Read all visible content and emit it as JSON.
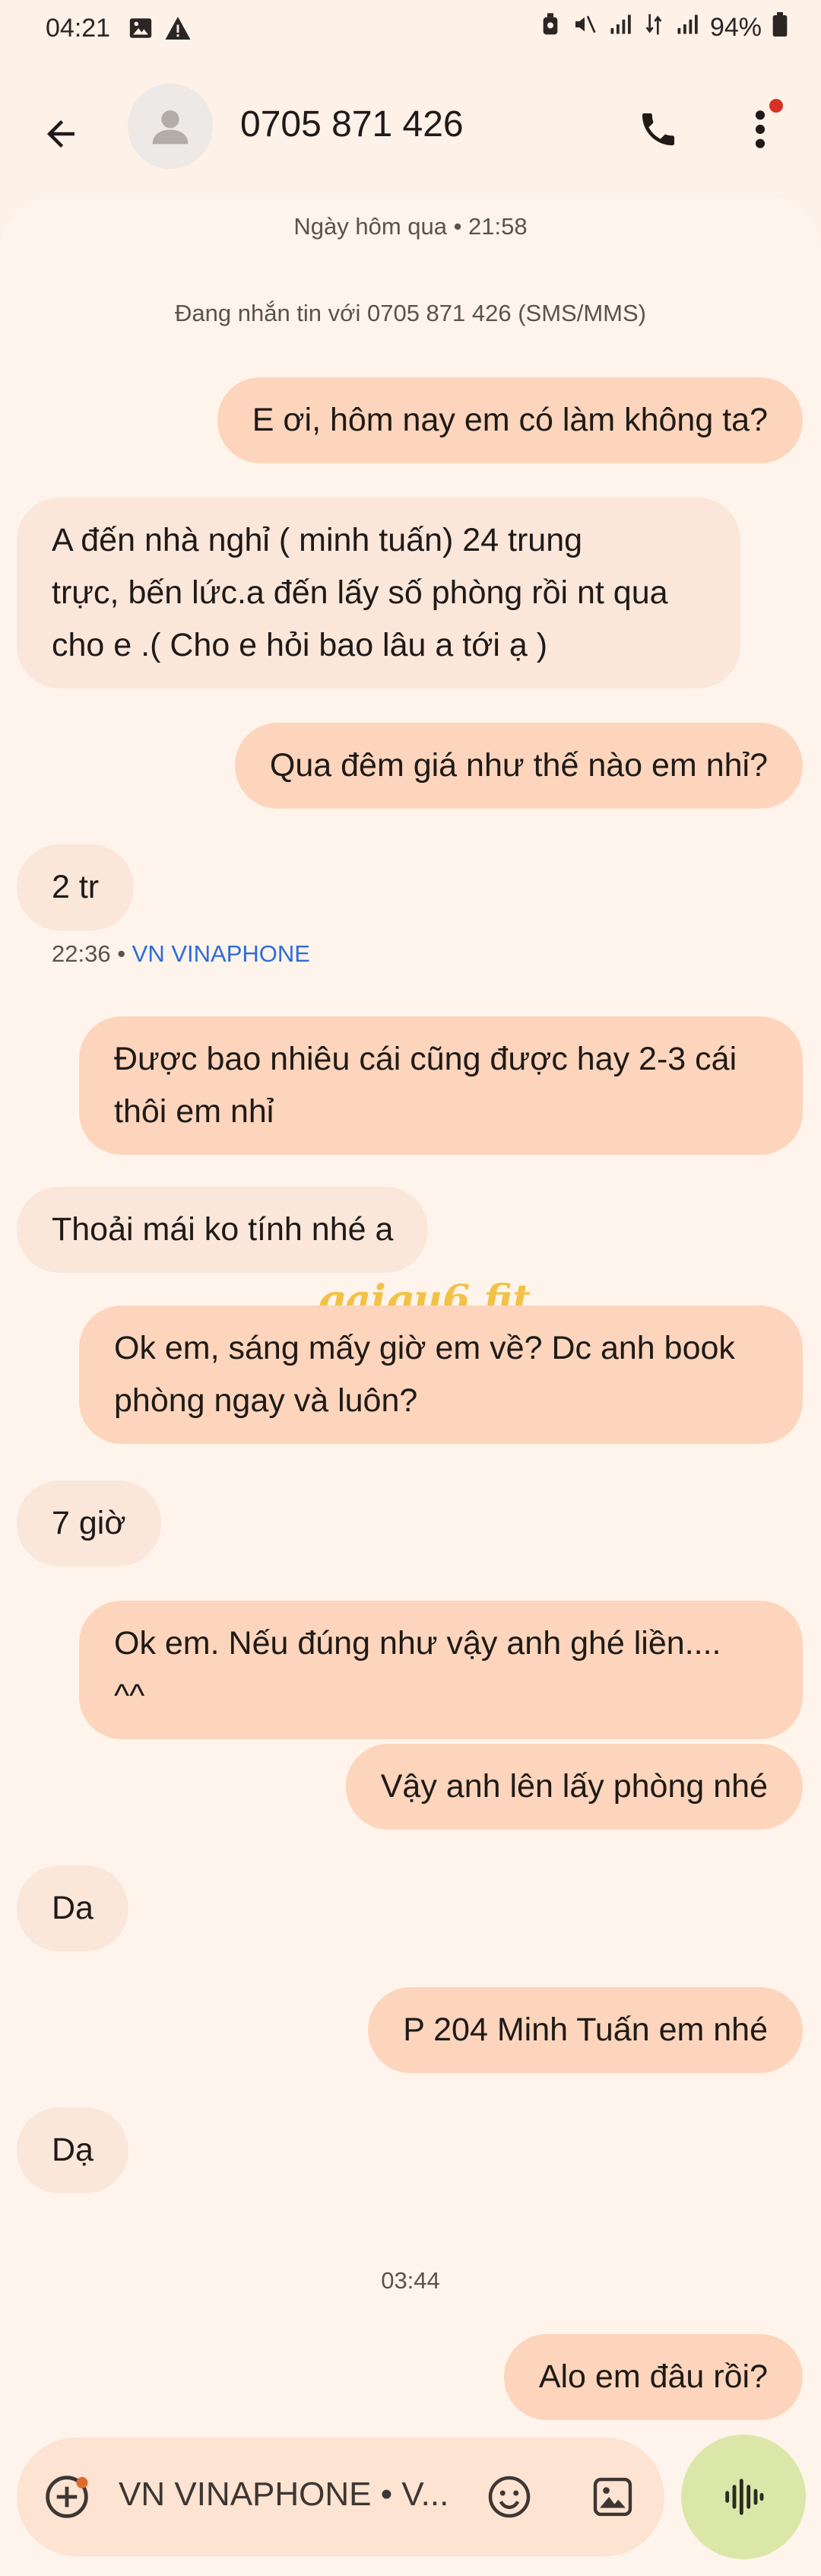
{
  "status": {
    "time": "04:21",
    "battery": "94%"
  },
  "header": {
    "contact": "0705 871 426"
  },
  "thread": {
    "date_label": "Ngày hôm qua • 21:58",
    "info_label": "Đang nhắn tin với 0705 871 426 (SMS/MMS)",
    "timestamp_time": "22:36 •",
    "timestamp_sim": "VN VINAPHONE",
    "time_divider": "03:44"
  },
  "messages": [
    {
      "dir": "out",
      "text": "E ơi, hôm nay em có làm không ta?"
    },
    {
      "dir": "in",
      "line1": "A đến nhà nghỉ ( minh tuấn)  24 trung",
      "line2": "trực, bến lức.a đến lấy số phòng rồi nt qua",
      "line3": "cho e .( Cho e hỏi bao lâu a tới ạ )"
    },
    {
      "dir": "out",
      "text": "Qua đêm giá như thế nào em nhỉ?"
    },
    {
      "dir": "in",
      "text": "2 tr"
    },
    {
      "dir": "out",
      "line1": "Được bao nhiêu cái cũng được hay 2-3 cái",
      "line2": "thôi em nhỉ"
    },
    {
      "dir": "in",
      "text": "Thoải mái ko tính nhé a"
    },
    {
      "dir": "out",
      "line1": "Ok em, sáng mấy giờ em về? Dc anh book",
      "line2": "phòng ngay và luôn?"
    },
    {
      "dir": "in",
      "text": "7 giờ"
    },
    {
      "dir": "out",
      "line1": "Ok em. Nếu đúng như vậy anh ghé liền....",
      "line2": "^^"
    },
    {
      "dir": "out",
      "text": "Vậy anh lên lấy phòng nhé"
    },
    {
      "dir": "in",
      "text": "Da"
    },
    {
      "dir": "out",
      "text": "P 204 Minh Tuấn em nhé"
    },
    {
      "dir": "in",
      "text": "Dạ"
    },
    {
      "dir": "out",
      "text": "Alo em đâu rồi?"
    }
  ],
  "watermark": "gaigu6.fit",
  "composer": {
    "text": "VN VINAPHONE • V..."
  },
  "icons": {
    "back": "arrow-left-icon",
    "avatar": "person-icon",
    "call": "phone-icon",
    "more": "more-vert-icon",
    "attach": "add-circle-icon",
    "emoji": "smiley-icon",
    "gallery": "image-icon",
    "voice": "waveform-icon"
  },
  "colors": {
    "background": "#fdf1e8",
    "incoming": "#fbe6da",
    "outgoing": "#fcd5bc",
    "sim_link": "#2f6cd8",
    "voice_button": "#dbe7a9",
    "badge": "#d93025"
  }
}
